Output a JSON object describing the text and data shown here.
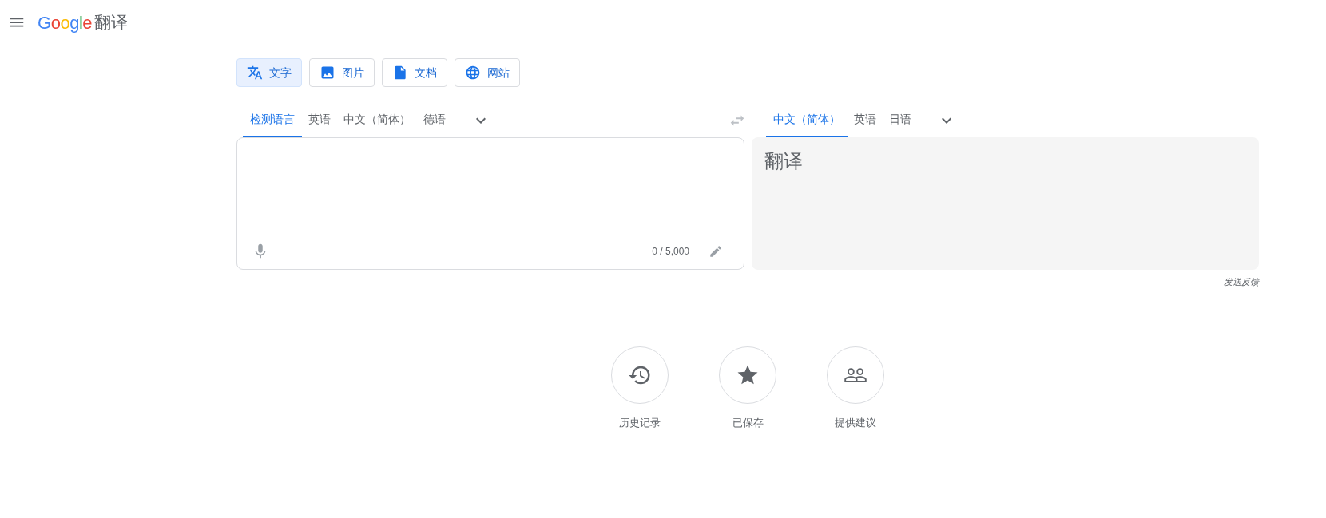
{
  "header": {
    "logo": "Google",
    "title": "翻译"
  },
  "modes": [
    {
      "kind": "text",
      "label": "文字",
      "selected": true
    },
    {
      "kind": "image",
      "label": "图片",
      "selected": false
    },
    {
      "kind": "document",
      "label": "文档",
      "selected": false
    },
    {
      "kind": "website",
      "label": "网站",
      "selected": false
    }
  ],
  "source_languages": [
    {
      "label": "检测语言",
      "selected": true
    },
    {
      "label": "英语",
      "selected": false
    },
    {
      "label": "中文（简体）",
      "selected": false
    },
    {
      "label": "德语",
      "selected": false
    }
  ],
  "target_languages": [
    {
      "label": "中文（简体）",
      "selected": true
    },
    {
      "label": "英语",
      "selected": false
    },
    {
      "label": "日语",
      "selected": false
    }
  ],
  "source_panel": {
    "char_count": "0 / 5,000"
  },
  "target_panel": {
    "text": "翻译"
  },
  "feedback_link": "发送反馈",
  "shortcuts": [
    {
      "kind": "history",
      "label": "历史记录"
    },
    {
      "kind": "saved",
      "label": "已保存"
    },
    {
      "kind": "contribute",
      "label": "提供建议"
    }
  ]
}
